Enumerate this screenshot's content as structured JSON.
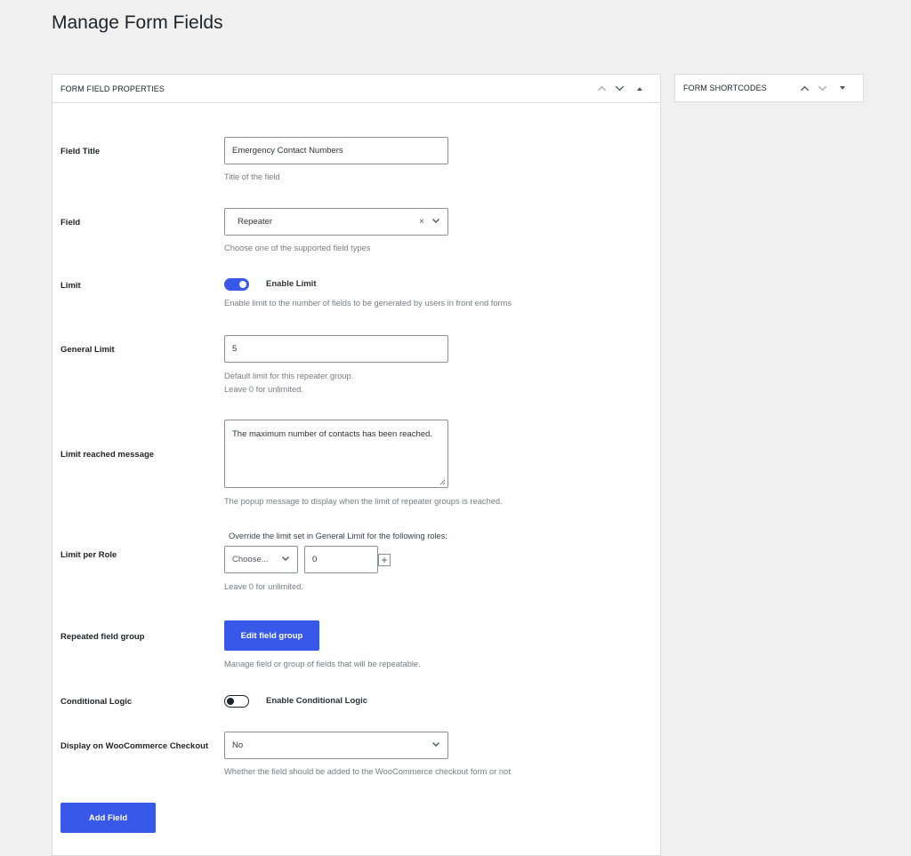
{
  "page": {
    "title": "Manage Form Fields"
  },
  "colors": {
    "accent": "#3858e9",
    "background": "#f0f0f1",
    "panel": "#ffffff",
    "muted_text": "#787c82"
  },
  "main_panel": {
    "title": "FORM FIELD PROPERTIES",
    "controls": [
      {
        "name": "move-up",
        "icon": "chevron-up-icon"
      },
      {
        "name": "move-down",
        "icon": "chevron-down-icon"
      },
      {
        "name": "toggle-panel",
        "icon": "triangle-up-icon"
      }
    ]
  },
  "side_panel": {
    "title": "FORM SHORTCODES",
    "controls": [
      {
        "name": "move-up",
        "icon": "chevron-up-icon"
      },
      {
        "name": "move-down",
        "icon": "chevron-down-icon"
      },
      {
        "name": "toggle-panel",
        "icon": "triangle-down-icon"
      }
    ]
  },
  "fields": {
    "field_title": {
      "label": "Field Title",
      "value": "Emergency Contact Numbers",
      "description": "Title of the field"
    },
    "field_type": {
      "label": "Field",
      "value": "Repeater",
      "clear_icon": "×",
      "description": "Choose one of the supported field types"
    },
    "limit": {
      "label": "Limit",
      "toggle_label": "Enable Limit",
      "enabled": true,
      "description": "Enable limit to the number of fields to be generated by users in front end forms"
    },
    "general_limit": {
      "label": "General Limit",
      "value": "5",
      "description_line1": "Default limit for this repeater group.",
      "description_line2": "Leave 0 for unlimited."
    },
    "limit_message": {
      "label": "Limit reached message",
      "value": "The maximum number of contacts has been reached.",
      "description": "The popup message to display when the limit of repeater groups is reached."
    },
    "limit_per_role": {
      "label": "Limit per Role",
      "intro": "Override the limit set in General Limit for the following roles:",
      "role_select": "Choose...",
      "role_value": "0",
      "add_icon": "+",
      "description": "Leave 0 for unlimited."
    },
    "repeated_group": {
      "label": "Repeated field group",
      "button": "Edit field group",
      "description": "Manage field or group of fields that will be repeatable."
    },
    "conditional_logic": {
      "label": "Conditional Logic",
      "toggle_label": "Enable Conditional Logic",
      "enabled": false
    },
    "woocommerce": {
      "label": "Display on WooCommerce Checkout",
      "value": "No",
      "description": "Whether the field should be added to the WooCommerce checkout form or not"
    }
  },
  "actions": {
    "add_field": "Add Field"
  }
}
